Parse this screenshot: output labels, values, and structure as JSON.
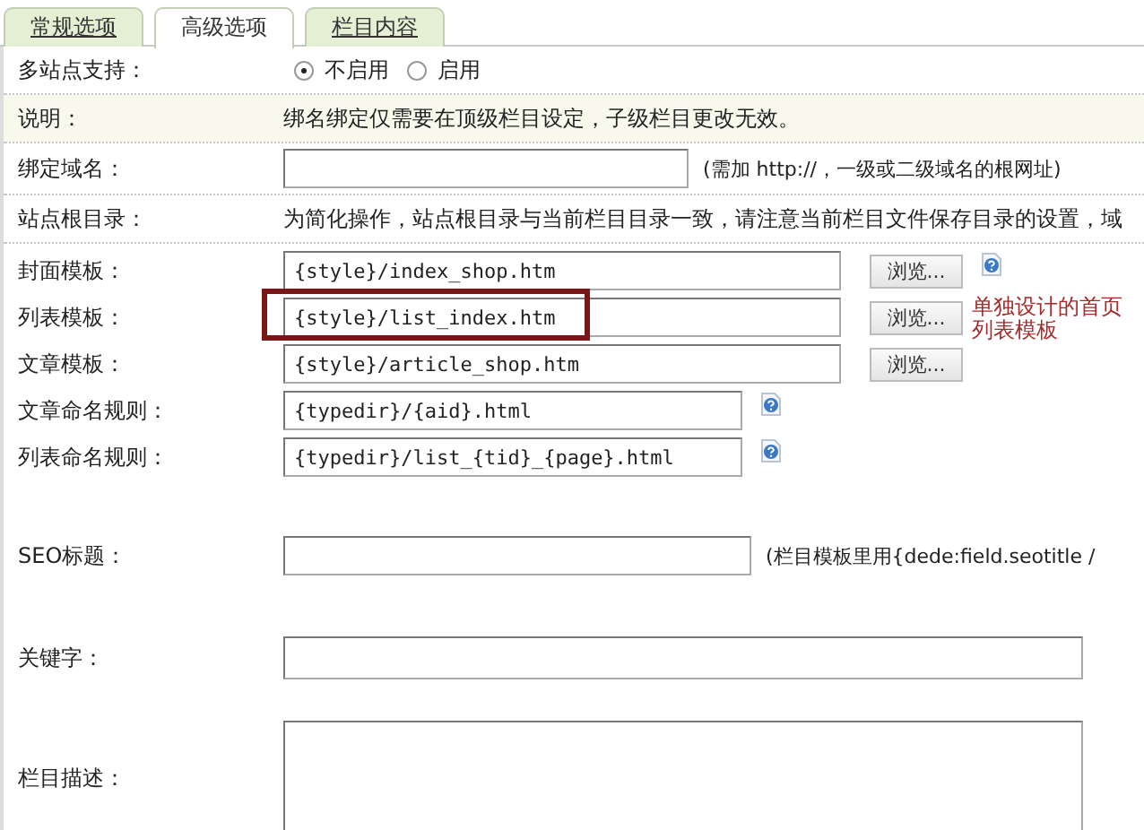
{
  "tabs": [
    {
      "label": "常规选项",
      "selected": false
    },
    {
      "label": "高级选项",
      "selected": true
    },
    {
      "label": "栏目内容",
      "selected": false
    }
  ],
  "rows": [
    {
      "kind": "radio",
      "label": "多站点支持：",
      "options": [
        {
          "label": "不启用",
          "selected": true
        },
        {
          "label": "启用",
          "selected": false
        }
      ]
    },
    {
      "kind": "note",
      "label": "说明：",
      "text": "绑名绑定仅需要在顶级栏目设定，子级栏目更改无效。"
    },
    {
      "kind": "domain",
      "label": "绑定域名：",
      "hint": "(需加 http://，一级或二级域名的根网址)"
    },
    {
      "kind": "info",
      "label": "站点根目录：",
      "text": "为简化操作，站点根目录与当前栏目目录一致，请注意当前栏目文件保存目录的设置，域"
    },
    {
      "kind": "template",
      "label": "封面模板：",
      "value": "{style}/index_shop.htm",
      "button": "浏览...",
      "help": true
    },
    {
      "kind": "template",
      "label": "列表模板：",
      "value": "{style}/list_index.htm",
      "button": "浏览...",
      "help": false,
      "annotation": "单独设计的首页列表模板"
    },
    {
      "kind": "template",
      "label": "文章模板：",
      "value": "{style}/article_shop.htm",
      "button": "浏览...",
      "help": false
    },
    {
      "kind": "rule",
      "label": "文章命名规则：",
      "value": "{typedir}/{aid}.html"
    },
    {
      "kind": "rule",
      "label": "列表命名规则：",
      "value": "{typedir}/list_{tid}_{page}.html"
    },
    {
      "kind": "seo",
      "label": "SEO标题：",
      "hint": "(栏目模板里用{dede:field.seotitle /"
    },
    {
      "kind": "keywords",
      "label": "关键字："
    },
    {
      "kind": "textarea",
      "label": "栏目描述："
    }
  ]
}
